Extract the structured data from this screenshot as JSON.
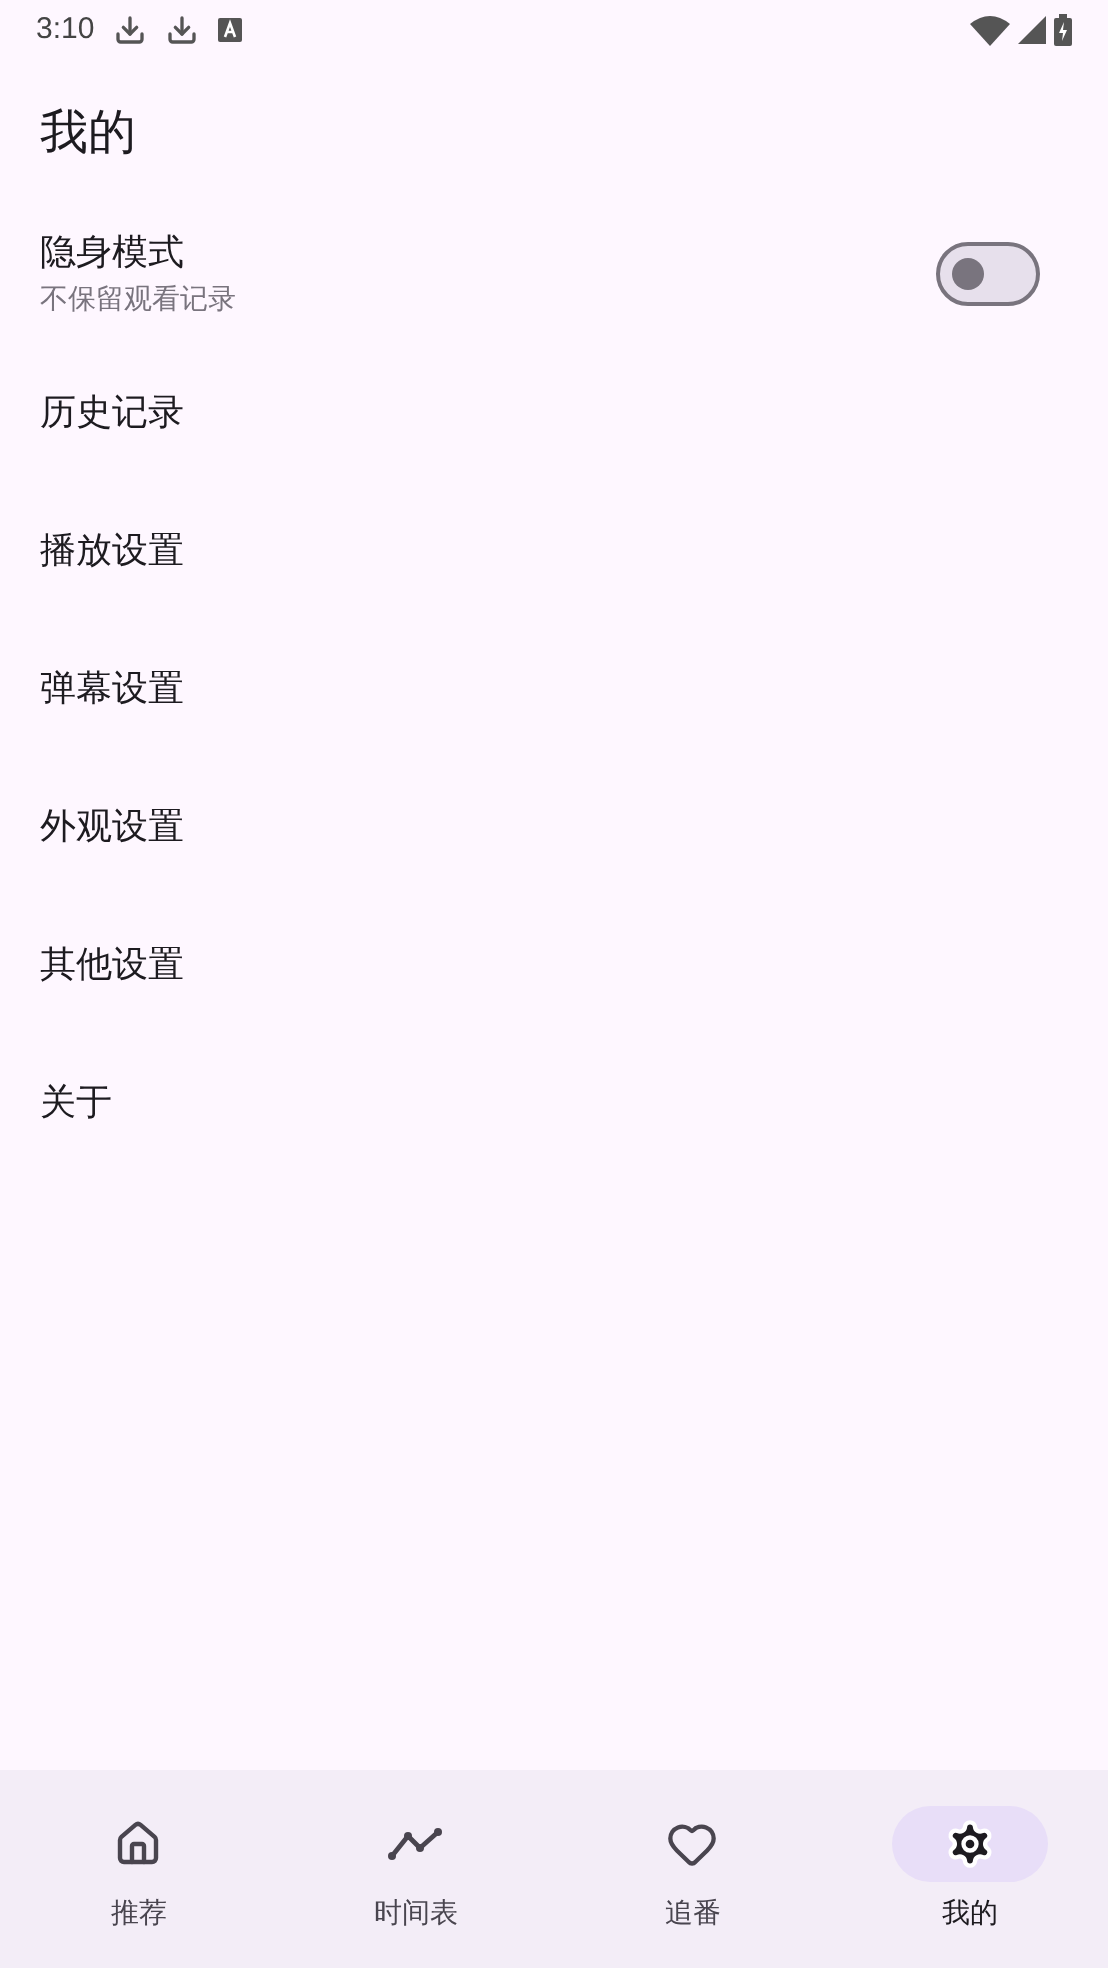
{
  "status_bar": {
    "time": "3:10"
  },
  "title": "我的",
  "incognito": {
    "label": "隐身模式",
    "description": "不保留观看记录",
    "on": false
  },
  "menu_items": [
    "历史记录",
    "播放设置",
    "弹幕设置",
    "外观设置",
    "其他设置",
    "关于"
  ],
  "nav": [
    {
      "kind": "home",
      "label": "推荐",
      "selected": false
    },
    {
      "kind": "timeline",
      "label": "时间表",
      "selected": false
    },
    {
      "kind": "heart",
      "label": "追番",
      "selected": false
    },
    {
      "kind": "settings",
      "label": "我的",
      "selected": true
    }
  ]
}
